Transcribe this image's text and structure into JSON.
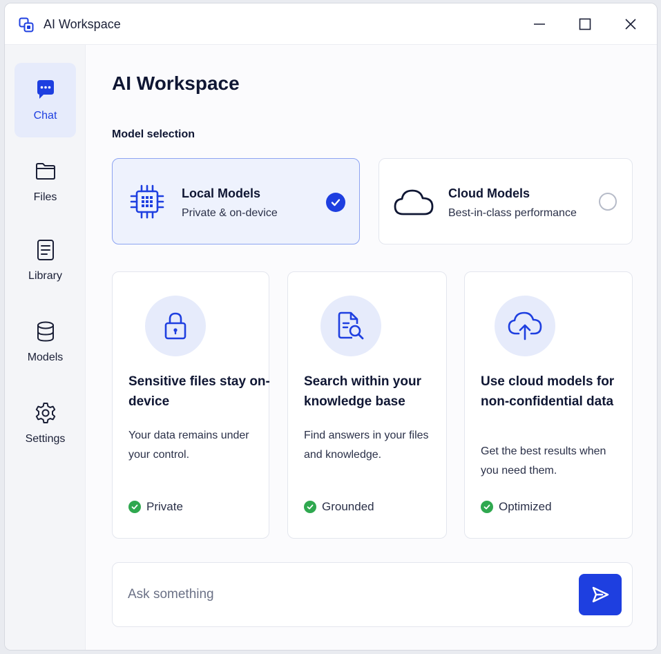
{
  "window": {
    "title": "AI Workspace"
  },
  "sidebar": {
    "items": [
      {
        "label": "Chat",
        "icon": "chat-bubble-icon",
        "active": true
      },
      {
        "label": "Files",
        "icon": "folder-icon"
      },
      {
        "label": "Library",
        "icon": "document-icon"
      },
      {
        "label": "Models",
        "icon": "database-icon"
      },
      {
        "label": "Settings",
        "icon": "gear-icon"
      }
    ]
  },
  "main": {
    "title": "AI Workspace",
    "section_label": "Model selection",
    "models": [
      {
        "name": "Local Models",
        "description": "Private & on-device",
        "icon": "chip-icon",
        "selected": true
      },
      {
        "name": "Cloud Models",
        "description": "Best-in-class performance",
        "icon": "cloud-icon",
        "selected": false
      }
    ],
    "features": [
      {
        "title": "Sensitive files stay on-device",
        "description": "Your data remains under your control.",
        "tag": "Private",
        "icon": "lock-icon"
      },
      {
        "title": "Search within your knowledge base",
        "description": "Find answers in your files and knowledge.",
        "tag": "Grounded",
        "icon": "document-search-icon"
      },
      {
        "title": "Use cloud models for non-confidential data",
        "description": "Get the best results when you need them.",
        "tag": "Optimized",
        "icon": "cloud-upload-icon"
      }
    ],
    "composer": {
      "placeholder": "Ask something",
      "value": ""
    }
  },
  "colors": {
    "accent": "#1e3fe0",
    "accent_soft": "#e6ebfb",
    "success": "#2fa84f"
  }
}
